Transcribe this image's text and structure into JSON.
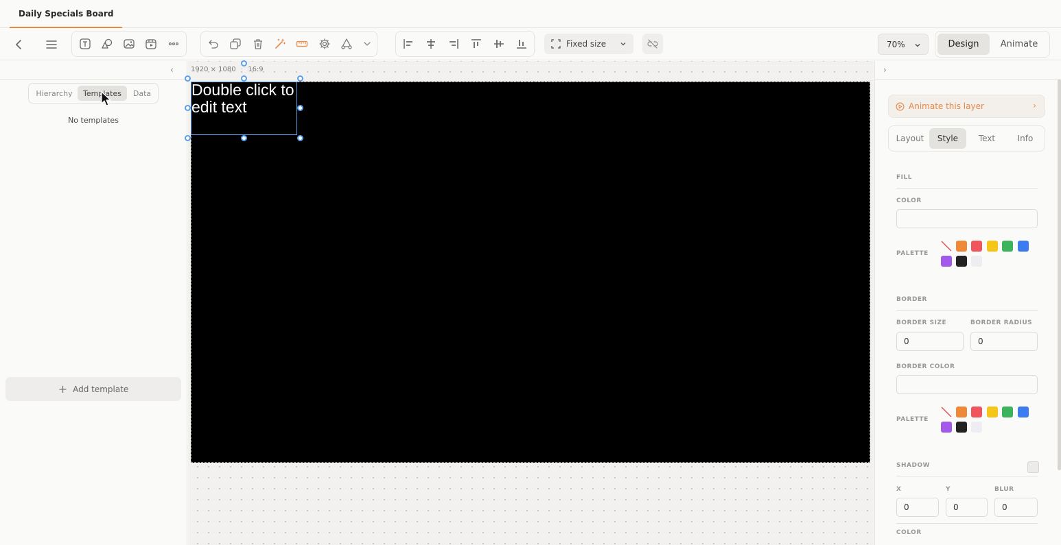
{
  "document": {
    "tab_title": "Daily Specials Board"
  },
  "toolbar": {
    "fixed_size_label": "Fixed size",
    "zoom_level": "70%",
    "mode_design": "Design",
    "mode_animate": "Animate"
  },
  "left_panel": {
    "tabs": [
      "Hierarchy",
      "Templates",
      "Data"
    ],
    "active_tab": "Templates",
    "empty_message": "No templates",
    "add_template_label": "Add template"
  },
  "canvas": {
    "dimensions": "1920 × 1080",
    "aspect": "16:9",
    "text_content": "Double click to edit text",
    "background_color": "#000000"
  },
  "right_panel": {
    "animate_layer_label": "Animate this layer",
    "tabs": [
      "Layout",
      "Style",
      "Text",
      "Info"
    ],
    "active_tab": "Style",
    "fill": {
      "section": "FILL",
      "color_label": "COLOR",
      "color_value": "",
      "palette_label": "PALETTE"
    },
    "border": {
      "section": "BORDER",
      "size_label": "BORDER SIZE",
      "size_value": "0",
      "radius_label": "BORDER RADIUS",
      "radius_value": "0",
      "color_label": "BORDER COLOR",
      "color_value": "",
      "palette_label": "PALETTE"
    },
    "shadow": {
      "section": "SHADOW",
      "x_label": "X",
      "x_value": "0",
      "y_label": "Y",
      "y_value": "0",
      "blur_label": "BLUR",
      "blur_value": "0",
      "color_label": "COLOR"
    },
    "palette_colors": [
      "none",
      "#F0883A",
      "#F0545C",
      "#F5C518",
      "#3BB45C",
      "#3B7CF0",
      "#A45AE8",
      "#222222",
      "#EEEEF2"
    ]
  },
  "colors": {
    "accent": "#E8894A",
    "selection": "#5AA0E8"
  }
}
